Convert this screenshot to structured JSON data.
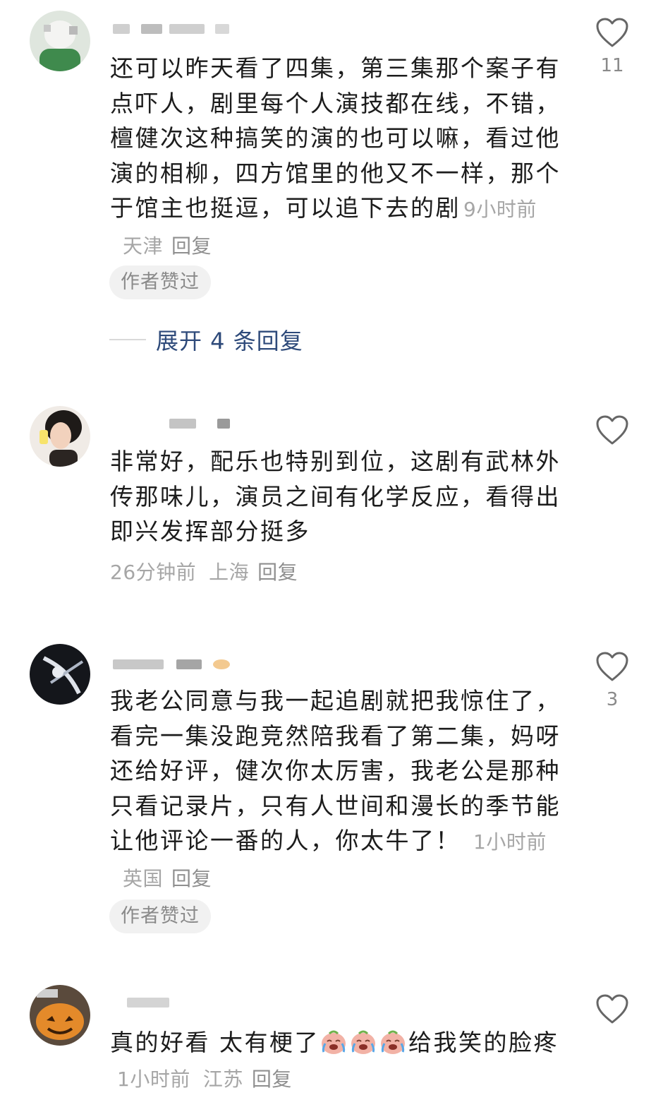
{
  "comments": [
    {
      "text": "还可以昨天看了四集，第三集那个案子有点吓人，剧里每个人演技都在线，不错，檀健次这种搞笑的演的也可以嘛，看过他演的相柳，四方馆里的他又不一样，那个于馆主也挺逗，可以追下去的剧",
      "time": "9小时前",
      "location": "天津",
      "reply": "回复",
      "likes": "11",
      "badge": "作者赞过",
      "expand": "展开 4 条回复"
    },
    {
      "text": "非常好，配乐也特别到位，这剧有武林外传那味儿，演员之间有化学反应，看得出即兴发挥部分挺多",
      "time": "26分钟前",
      "location": "上海",
      "reply": "回复",
      "likes": ""
    },
    {
      "text": "我老公同意与我一起追剧就把我惊住了，看完一集没跑竞然陪我看了第二集，妈呀还给好评，健次你太厉害，我老公是那种只看记录片，只有人世间和漫长的季节能让他评论一番的人，你太牛了！",
      "time": "1小时前",
      "location": "英国",
      "reply": "回复",
      "likes": "3",
      "badge": "作者赞过"
    },
    {
      "text_before": "真的好看 太有梗了",
      "emojis": [
        "crying-laugh-emoji",
        "crying-laugh-emoji",
        "crying-laugh-emoji"
      ],
      "text_after": "给我笑的脸疼",
      "time": "1小时前",
      "location": "江苏",
      "reply": "回复",
      "likes": ""
    }
  ],
  "icons": {
    "like": "heart-outline-icon"
  },
  "colors": {
    "link": "#2e4a7a",
    "meta": "#a6a6a6",
    "badge_bg": "#f1f1f1"
  }
}
